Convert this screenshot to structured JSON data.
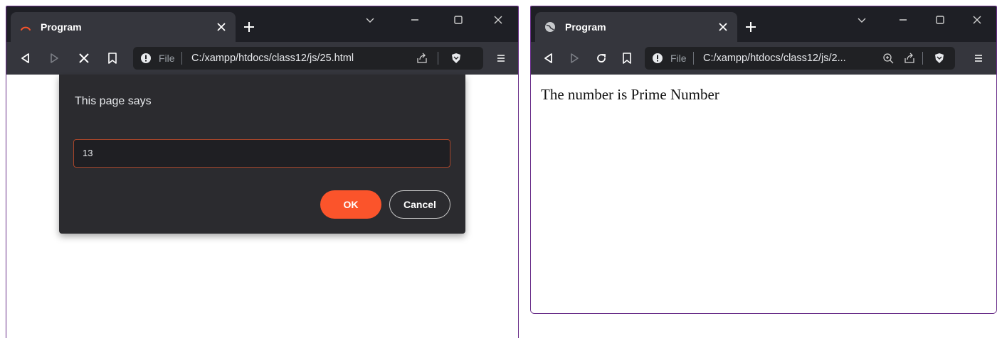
{
  "colors": {
    "accent": "#fb542b",
    "titlebar": "#1e1f25",
    "toolbar": "#35363d",
    "omnibox": "#202124",
    "dialog": "#2b2b2f",
    "window_border": "#6a2f8a"
  },
  "left_window": {
    "tab_title": "Program",
    "favicon": "loading-spinner-icon",
    "omnibox": {
      "scheme_label": "File",
      "url": "C:/xampp/htdocs/class12/js/25.html"
    },
    "dialog": {
      "message": "This page says",
      "input_value": "13",
      "ok_label": "OK",
      "cancel_label": "Cancel"
    }
  },
  "right_window": {
    "tab_title": "Program",
    "favicon": "globe-icon",
    "omnibox": {
      "scheme_label": "File",
      "url": "C:/xampp/htdocs/class12/js/2..."
    },
    "page_text": "The number is Prime Number"
  }
}
